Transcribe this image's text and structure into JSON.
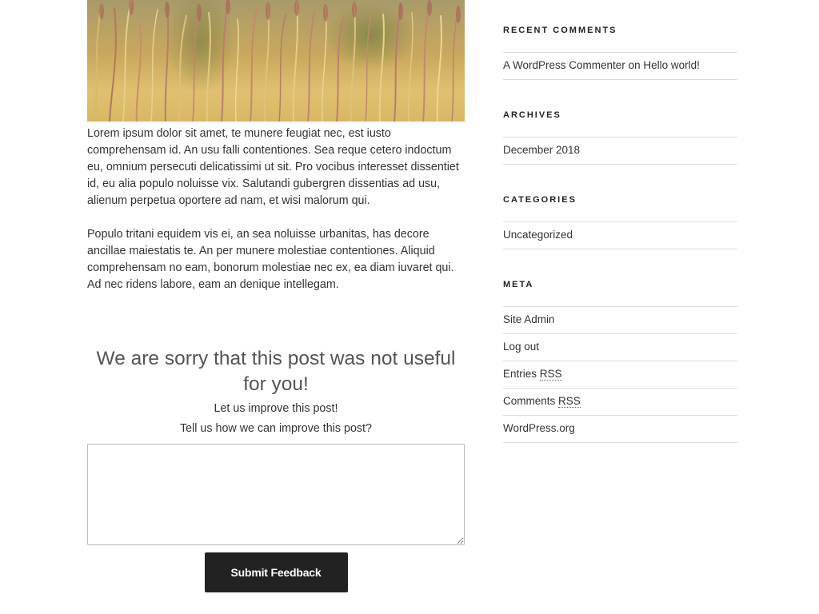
{
  "post": {
    "paragraphs": [
      "Lorem ipsum dolor sit amet, te munere feugiat nec, est iusto comprehensam id. An usu falli contentiones. Sea reque cetero indoctum eu, omnium persecuti delicatissimi ut sit. Pro vocibus interesset dissentiet id, eu alia populo noluisse vix. Salutandi gubergren dissentias ad usu, alienum perpetua oportere ad nam, et wisi malorum qui.",
      "Populo tritani equidem vis ei, an sea noluisse urbanitas, has decore ancillae maiestatis te. An per munere molestiae contentiones. Aliquid comprehensam no eam, bonorum molestiae nec ex, ea diam iuvaret qui. Ad nec ridens labore, eam an denique intellegam."
    ]
  },
  "feedback": {
    "heading": "We are sorry that this post was not useful for you!",
    "line1": "Let us improve this post!",
    "line2": "Tell us how we can improve this post?",
    "textarea_value": "",
    "submit_label": "Submit Feedback"
  },
  "sidebar": {
    "recent_comments": {
      "title": "Recent Comments",
      "author": "A WordPress Commenter",
      "on": "on",
      "post": "Hello world!"
    },
    "archives": {
      "title": "Archives",
      "items": [
        "December 2018"
      ]
    },
    "categories": {
      "title": "Categories",
      "items": [
        "Uncategorized"
      ]
    },
    "meta": {
      "title": "Meta",
      "site_admin": "Site Admin",
      "log_out": "Log out",
      "entries": "Entries",
      "comments": "Comments",
      "rss": "RSS",
      "wordpress_org": "WordPress.org"
    }
  }
}
